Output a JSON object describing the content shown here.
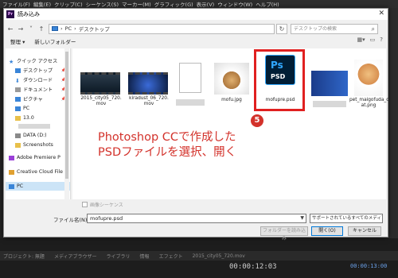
{
  "app": {
    "menu": [
      "ファイル(F)",
      "編集(E)",
      "クリップ(C)",
      "シーケンス(S)",
      "マーカー(M)",
      "グラフィック(G)",
      "表示(V)",
      "ウィンドウ(W)",
      "ヘルプ(H)"
    ],
    "panel_tabs": [
      "プロジェクト: 無題",
      "メディアブラウザー",
      "ライブラリ",
      "情報",
      "エフェクト",
      "2015_city05_720.mov"
    ],
    "timecode_left": "00:00:12:03",
    "timecode_right": "00:00:13:00"
  },
  "dialog": {
    "title": "読み込み",
    "address": {
      "path1": "PC",
      "path2": "デスクトップ"
    },
    "search_placeholder": "デスクトップの検索",
    "toolbar": {
      "organize": "整理 ▾",
      "new_folder": "新しいフォルダー"
    },
    "nav": [
      {
        "label": "クイック アクセス",
        "icon": "star-icon",
        "color": "#3a85d8"
      },
      {
        "label": "デスクトップ",
        "icon": "desktop-icon",
        "color": "#3a85d8",
        "pin": true
      },
      {
        "label": "ダウンロード",
        "icon": "download-icon",
        "color": "#3a85d8",
        "pin": true
      },
      {
        "label": "ドキュメント",
        "icon": "document-icon",
        "color": "#8a8a8a",
        "pin": true
      },
      {
        "label": "ピクチャ",
        "icon": "picture-icon",
        "color": "#3a85d8",
        "pin": true
      },
      {
        "label": "PC",
        "icon": "pc-icon",
        "color": "#3a85d8"
      },
      {
        "label": "13.0",
        "icon": "folder-icon",
        "color": "#e8c04a"
      },
      {
        "label": "DATA (D:)",
        "icon": "drive-icon",
        "color": "#8a8a8a"
      },
      {
        "label": "Screenshots",
        "icon": "folder-icon",
        "color": "#e8c04a"
      },
      {
        "label": "Adobe Premiere P",
        "icon": "premiere-icon",
        "color": "#9a3fd8"
      },
      {
        "label": "Creative Cloud File",
        "icon": "cloud-icon",
        "color": "#e0a030"
      },
      {
        "label": "PC",
        "icon": "pc-icon",
        "color": "#3a85d8"
      }
    ],
    "files": [
      {
        "name": "2015_city05_720.\nmov"
      },
      {
        "name": "kiradust_06_720.\nmov"
      },
      {
        "name": ""
      },
      {
        "name": "mofu.jpg"
      },
      {
        "name": "mofupre.psd"
      },
      {
        "name": ""
      },
      {
        "name": "pet_maigofuda_c\nat.png"
      }
    ],
    "annotation": {
      "line1": "Photoshop CCで作成した",
      "line2": "PSDファイルを選択、開く",
      "step": "5"
    },
    "image_sequence": "画像シーケンス",
    "filename_label": "ファイル名(N):",
    "filename_value": "mofupre.psd",
    "filter_value": "サポートされているすべてのメディア (*.*)",
    "buttons": {
      "import_folder": "フォルダーを読み込み",
      "open": "開く(O)",
      "cancel": "キャンセル"
    }
  }
}
